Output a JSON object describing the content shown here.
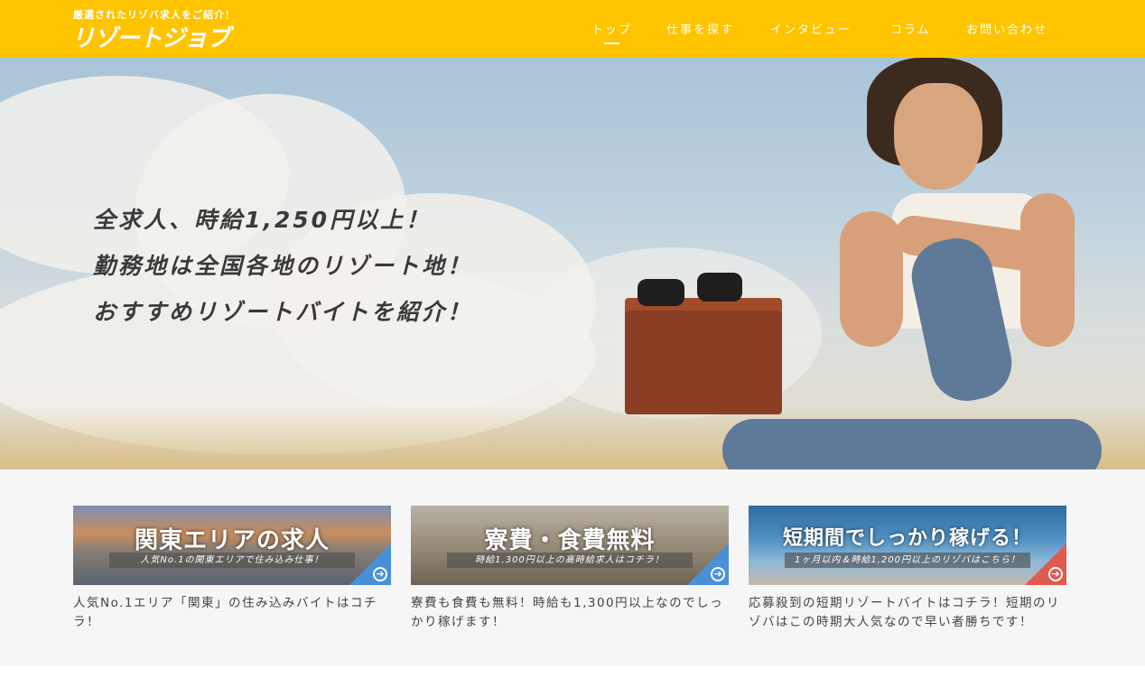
{
  "header": {
    "tagline": "厳選されたリゾバ求人をご紹介！",
    "logo": "リゾートジョブ",
    "bg_color": "#ffc400",
    "nav": [
      {
        "label": "トップ",
        "active": true
      },
      {
        "label": "仕事を探す"
      },
      {
        "label": "インタビュー"
      },
      {
        "label": "コラム"
      },
      {
        "label": "お問い合わせ"
      }
    ]
  },
  "hero": {
    "lines": [
      "全求人、時給1,250円以上！",
      "勤務地は全国各地のリゾート地！",
      "おすすめリゾートバイトを紹介！"
    ]
  },
  "cards": [
    {
      "title": "関東エリアの求人",
      "subtitle": "人気No.1の関東エリアで住み込み仕事！",
      "description": "人気No.1エリア「関東」の住み込みバイトはコチラ！",
      "accent": "#4a90d9"
    },
    {
      "title": "寮費・食費無料",
      "subtitle": "時給1,300円以上の高時給求人はコチラ！",
      "description": "寮費も食費も無料！時給も1,300円以上なのでしっかり稼げます！",
      "accent": "#4a90d9"
    },
    {
      "title": "短期間でしっかり稼げる！",
      "subtitle": "1ヶ月以内＆時給1,200円以上のリゾバはこちら！",
      "description": "応募殺到の短期リゾートバイトはコチラ！短期のリゾバはこの時期大人気なので早い者勝ちです！",
      "accent": "#e05a4f"
    }
  ],
  "icons": {
    "card_arrow": "arrow-right-circle-icon"
  }
}
